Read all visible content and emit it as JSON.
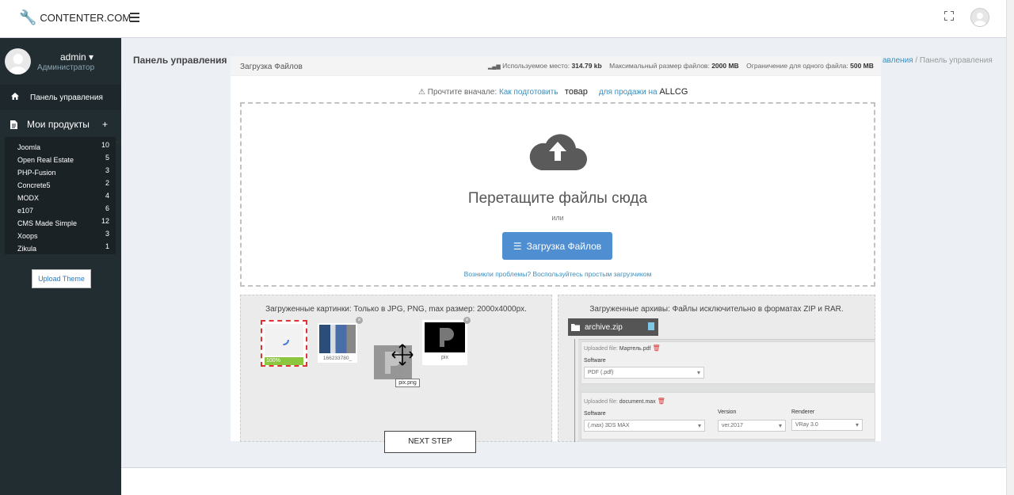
{
  "header": {
    "brand": "CONTENTER.COM"
  },
  "user": {
    "name": "admin",
    "role": "Администратор"
  },
  "sidebar": {
    "dashboard": "Панель управления",
    "my_products": "Мои продукты",
    "products": [
      {
        "name": "Joomla",
        "count": "10"
      },
      {
        "name": "Open Real Estate",
        "count": "5"
      },
      {
        "name": "PHP-Fusion",
        "count": "3"
      },
      {
        "name": "Concrete5",
        "count": "2"
      },
      {
        "name": "MODX",
        "count": "4"
      },
      {
        "name": "e107",
        "count": "6"
      },
      {
        "name": "CMS Made Simple",
        "count": "12"
      },
      {
        "name": "Xoops",
        "count": "3"
      },
      {
        "name": "Zikula",
        "count": "1"
      }
    ],
    "upload_theme": "Upload Theme"
  },
  "page": {
    "title": "Панель управления",
    "breadcrumb_link": "авления",
    "breadcrumb_current": "Панель управления"
  },
  "panel": {
    "title": "Загрузка Файлов",
    "used_label": "Используемое место:",
    "used_value": "314.79 kb",
    "max_label": "Максимальный размер файлов:",
    "max_value": "2000 MB",
    "limit_label": "Ограничение для одного файла:",
    "limit_value": "500 MB"
  },
  "notice": {
    "prefix": "Прочтите вначале:",
    "link1": "Как подготовить",
    "word": "товар",
    "link2": "для продажи на",
    "brand": "ALLCG"
  },
  "dropzone": {
    "title": "Перетащите файлы сюда",
    "or": "или",
    "button": "Загрузка Файлов",
    "problem": "Возникли проблемы? Воспользуйтесь простым загрузчиком"
  },
  "images": {
    "title": "Загруженные картинки: Только в JPG, PNG, max размер: 2000x4000px.",
    "progress": "100%",
    "thumb2_caption": "166233780_",
    "thumb4_caption": "pix",
    "drag_label": "pix.png"
  },
  "archives": {
    "title": "Загруженные архивы: Файлы исключительно в форматах ZIP и RAR.",
    "archive_name": "archive.zip",
    "file1": {
      "caption": "Uploaded file:",
      "name": "Мартель.pdf",
      "software_label": "Software",
      "software_value": "PDF (.pdf)"
    },
    "file2": {
      "caption": "Uploaded file:",
      "name": "document.max",
      "software_label": "Software",
      "software_value": "(.max) 3DS MAX",
      "version_label": "Version",
      "version_value": "ver.2017",
      "renderer_label": "Renderer",
      "renderer_value": "VRay 3.0"
    }
  },
  "next_step": "NEXT STEP"
}
